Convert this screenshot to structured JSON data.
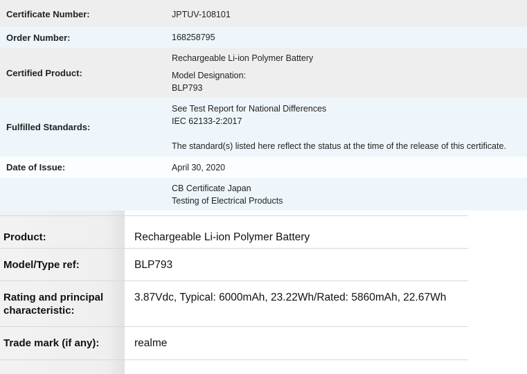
{
  "certificate": {
    "certificate_number_label": "Certificate Number:",
    "certificate_number": "JPTUV-108101",
    "order_number_label": "Order Number:",
    "order_number": "168258795",
    "certified_product_label": "Certified Product:",
    "certified_product": "Rechargeable Li-ion Polymer Battery",
    "model_designation_label": "Model Designation:",
    "model_designation": "BLP793",
    "fulfilled_standards_label": "Fulfilled Standards:",
    "standards_line1": "See Test Report for National Differences",
    "standards_line2": "IEC 62133-2:2017",
    "standards_note": "The standard(s) listed here reflect the status at the time of the release of this certificate.",
    "date_of_issue_label": "Date of Issue:",
    "date_of_issue": "April 30, 2020",
    "scheme_line1": "CB Certificate Japan",
    "scheme_line2": "Testing of Electrical Products"
  },
  "cb_details": {
    "product_label": "Product:",
    "product": "Rechargeable Li-ion Polymer Battery",
    "model_label": "Model/Type ref:",
    "model": "BLP793",
    "rating_label": "Rating and principal characteristic:",
    "rating": "3.87Vdc, Typical: 6000mAh, 23.22Wh/Rated: 5860mAh, 22.67Wh",
    "trademark_label": "Trade mark (if any):",
    "trademark": "realme"
  }
}
